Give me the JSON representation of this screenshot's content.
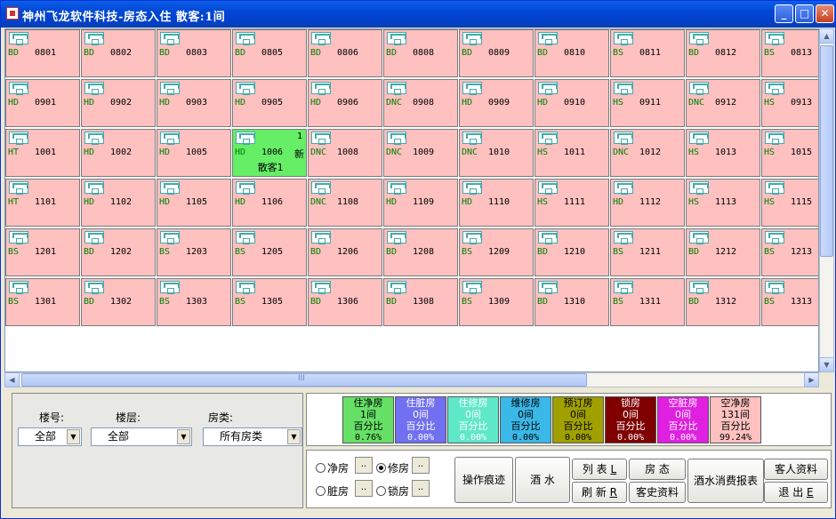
{
  "title": "神州飞龙软件科技-房态入住  散客:1间",
  "window_buttons": {
    "min": "_",
    "max": "□",
    "close": "✕"
  },
  "rooms": [
    {
      "t": "BD",
      "n": "0801"
    },
    {
      "t": "BD",
      "n": "0802"
    },
    {
      "t": "BD",
      "n": "0803"
    },
    {
      "t": "BD",
      "n": "0805"
    },
    {
      "t": "BD",
      "n": "0806"
    },
    {
      "t": "BD",
      "n": "0808"
    },
    {
      "t": "BD",
      "n": "0809"
    },
    {
      "t": "BD",
      "n": "0810"
    },
    {
      "t": "BS",
      "n": "0811"
    },
    {
      "t": "BD",
      "n": "0812"
    },
    {
      "t": "BS",
      "n": "0813"
    },
    {
      "t": "HD",
      "n": "0901"
    },
    {
      "t": "HD",
      "n": "0902"
    },
    {
      "t": "HD",
      "n": "0903"
    },
    {
      "t": "HD",
      "n": "0905"
    },
    {
      "t": "HD",
      "n": "0906"
    },
    {
      "t": "DNC",
      "n": "0908"
    },
    {
      "t": "HD",
      "n": "0909"
    },
    {
      "t": "HD",
      "n": "0910"
    },
    {
      "t": "HS",
      "n": "0911"
    },
    {
      "t": "DNC",
      "n": "0912"
    },
    {
      "t": "HS",
      "n": "0913"
    },
    {
      "t": "HT",
      "n": "1001"
    },
    {
      "t": "HD",
      "n": "1002"
    },
    {
      "t": "HD",
      "n": "1005"
    },
    {
      "t": "HD",
      "n": "1006",
      "active": true,
      "q": "1",
      "s": "新",
      "g": "散客1"
    },
    {
      "t": "DNC",
      "n": "1008"
    },
    {
      "t": "DNC",
      "n": "1009"
    },
    {
      "t": "DNC",
      "n": "1010"
    },
    {
      "t": "HS",
      "n": "1011"
    },
    {
      "t": "DNC",
      "n": "1012"
    },
    {
      "t": "HS",
      "n": "1013"
    },
    {
      "t": "HS",
      "n": "1015"
    },
    {
      "t": "HT",
      "n": "1101"
    },
    {
      "t": "HD",
      "n": "1102"
    },
    {
      "t": "HD",
      "n": "1105"
    },
    {
      "t": "HD",
      "n": "1106"
    },
    {
      "t": "DNC",
      "n": "1108"
    },
    {
      "t": "HD",
      "n": "1109"
    },
    {
      "t": "HD",
      "n": "1110"
    },
    {
      "t": "HS",
      "n": "1111"
    },
    {
      "t": "HD",
      "n": "1112"
    },
    {
      "t": "HS",
      "n": "1113"
    },
    {
      "t": "HS",
      "n": "1115"
    },
    {
      "t": "BS",
      "n": "1201"
    },
    {
      "t": "BD",
      "n": "1202"
    },
    {
      "t": "BS",
      "n": "1203"
    },
    {
      "t": "BS",
      "n": "1205"
    },
    {
      "t": "BD",
      "n": "1206"
    },
    {
      "t": "BD",
      "n": "1208"
    },
    {
      "t": "BS",
      "n": "1209"
    },
    {
      "t": "BD",
      "n": "1210"
    },
    {
      "t": "BS",
      "n": "1211"
    },
    {
      "t": "BD",
      "n": "1212"
    },
    {
      "t": "BS",
      "n": "1213"
    },
    {
      "t": "BS",
      "n": "1301"
    },
    {
      "t": "BD",
      "n": "1302"
    },
    {
      "t": "BS",
      "n": "1303"
    },
    {
      "t": "BS",
      "n": "1305"
    },
    {
      "t": "BD",
      "n": "1306"
    },
    {
      "t": "BD",
      "n": "1308"
    },
    {
      "t": "BS",
      "n": "1309"
    },
    {
      "t": "BD",
      "n": "1310"
    },
    {
      "t": "BS",
      "n": "1311"
    },
    {
      "t": "BD",
      "n": "1312"
    },
    {
      "t": "BS",
      "n": "1313"
    }
  ],
  "filters": {
    "building_label": "楼号:",
    "building_value": "全部",
    "floor_label": "楼层:",
    "floor_value": "全部",
    "type_label": "房类:",
    "type_value": "所有房类"
  },
  "stats": [
    {
      "name": "住净房",
      "count": "1间",
      "pl": "百分比",
      "pct": "0.76%",
      "bg": "#66e066",
      "fg": "#000"
    },
    {
      "name": "住脏房",
      "count": "0间",
      "pl": "百分比",
      "pct": "0.00%",
      "bg": "#7070f0",
      "fg": "#fff"
    },
    {
      "name": "住修房",
      "count": "0间",
      "pl": "百分比",
      "pct": "0.00%",
      "bg": "#5fe8c8",
      "fg": "#fff"
    },
    {
      "name": "维修房",
      "count": "0间",
      "pl": "百分比",
      "pct": "0.00%",
      "bg": "#3ab8e8",
      "fg": "#000"
    },
    {
      "name": "预订房",
      "count": "0间",
      "pl": "百分比",
      "pct": "0.00%",
      "bg": "#a0a000",
      "fg": "#000"
    },
    {
      "name": "锁房",
      "count": "0间",
      "pl": "百分比",
      "pct": "0.00%",
      "bg": "#800000",
      "fg": "#fff"
    },
    {
      "name": "空脏房",
      "count": "0间",
      "pl": "百分比",
      "pct": "0.00%",
      "bg": "#e020e0",
      "fg": "#fff"
    },
    {
      "name": "空净房",
      "count": "131间",
      "pl": "百分比",
      "pct": "99.24%",
      "bg": "#ffc0c0",
      "fg": "#000"
    }
  ],
  "radios": {
    "clean": "净房",
    "repair": "修房",
    "dirty": "脏房",
    "lock": "锁房",
    "dots": "..",
    "selected": "repair"
  },
  "buttons": {
    "trace": "操作痕迹",
    "drink": "酒 水",
    "list": "列 表",
    "list_key": "L",
    "status": "房  态",
    "refresh": "刷 新",
    "refresh_key": "R",
    "history": "客史资料",
    "report": "酒水消费报表",
    "guest": "客人资料",
    "exit": "退  出",
    "exit_key": "E"
  },
  "hscroll_grip": "III"
}
